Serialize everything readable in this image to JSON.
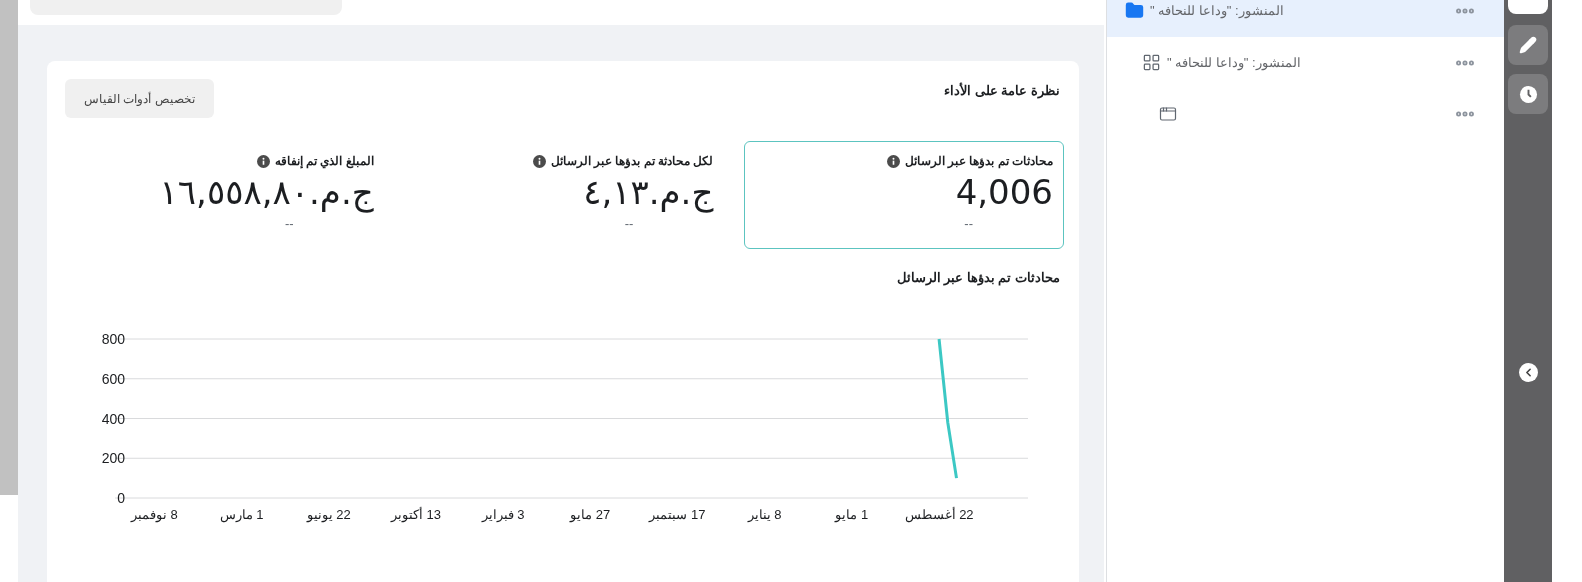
{
  "card": {
    "title": "نظرة عامة على الأداء",
    "customize_button": "تخصيص أدوات القياس",
    "metrics": [
      {
        "label": "محادثات تم بدؤها عبر الرسائل",
        "value": "4,006",
        "comparison": "--",
        "selected": true
      },
      {
        "label": "لكل محادثة تم بدؤها عبر الرسائل",
        "value": "ج.م.٤,١٣",
        "comparison": "--",
        "selected": false
      },
      {
        "label": "المبلغ الذي تم إنفاقه",
        "value": "ج.م.١٦,٥٥٨,٨٠",
        "comparison": "--",
        "selected": false
      }
    ],
    "chart_title": "محادثات تم بدؤها عبر الرسائل",
    "chart_data": {
      "type": "line",
      "grid": true,
      "ylim": [
        0,
        800
      ],
      "yticks": [
        0,
        200,
        400,
        600,
        800
      ],
      "categories": [
        "8 نوفمبر",
        null,
        null,
        null,
        null,
        null,
        null,
        null,
        null,
        null,
        "1 مارس",
        null,
        null,
        null,
        null,
        null,
        null,
        null,
        null,
        null,
        "22 يونيو",
        null,
        null,
        null,
        null,
        null,
        null,
        null,
        null,
        null,
        "13 أكتوبر",
        null,
        null,
        null,
        null,
        null,
        null,
        null,
        null,
        null,
        "3 فبراير",
        null,
        null,
        null,
        null,
        null,
        null,
        null,
        null,
        null,
        "27 مايو",
        null,
        null,
        null,
        null,
        null,
        null,
        null,
        null,
        null,
        "17 سبتمبر",
        null,
        null,
        null,
        null,
        null,
        null,
        null,
        null,
        null,
        "8 يناير",
        null,
        null,
        null,
        null,
        null,
        null,
        null,
        null,
        null,
        "1 مايو",
        null,
        null,
        null,
        null,
        null,
        null,
        null,
        null,
        null,
        "22 أغسطس",
        null,
        null,
        null,
        null,
        null,
        null,
        null,
        null,
        null
      ],
      "series": [
        {
          "color": "#3cc8c4",
          "values": [
            null,
            null,
            null,
            null,
            null,
            null,
            null,
            null,
            null,
            null,
            null,
            null,
            null,
            null,
            null,
            null,
            null,
            null,
            null,
            null,
            null,
            null,
            null,
            null,
            null,
            null,
            null,
            null,
            null,
            null,
            null,
            null,
            null,
            null,
            null,
            null,
            null,
            null,
            null,
            null,
            null,
            null,
            null,
            null,
            null,
            null,
            null,
            null,
            null,
            null,
            null,
            null,
            null,
            null,
            null,
            null,
            null,
            null,
            null,
            null,
            null,
            null,
            null,
            null,
            null,
            null,
            null,
            null,
            null,
            null,
            null,
            null,
            null,
            null,
            null,
            null,
            null,
            null,
            null,
            null,
            null,
            null,
            null,
            null,
            null,
            null,
            null,
            null,
            null,
            null,
            800,
            380,
            100,
            null,
            null,
            null,
            null,
            null,
            null,
            null
          ]
        }
      ]
    }
  },
  "tree": [
    {
      "kind": "folder",
      "label": "المنشور: \"وداعا للنحافه \"",
      "selected": true,
      "children": [
        {
          "kind": "grid",
          "label": "المنشور: \"وداعا للنحافه \"",
          "selected": false,
          "children": [
            {
              "kind": "window",
              "selected": false
            }
          ]
        }
      ]
    }
  ]
}
